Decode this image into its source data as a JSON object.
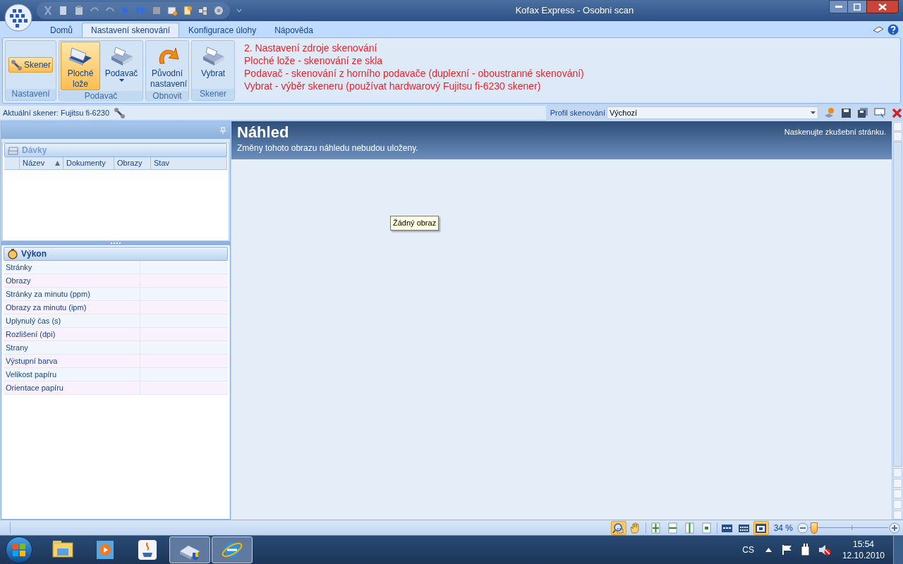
{
  "window": {
    "title": "Kofax Express - Osobni scan"
  },
  "tabs": [
    {
      "label": "Domů",
      "selected": false
    },
    {
      "label": "Nastavení skenování",
      "selected": true
    },
    {
      "label": "Konfigurace úlohy",
      "selected": false
    },
    {
      "label": "Nápověda",
      "selected": false
    }
  ],
  "ribbon": {
    "groups": [
      {
        "label": "Nastavení",
        "buttons": [
          {
            "label": "Skener",
            "kind": "setup",
            "selected": true
          }
        ]
      },
      {
        "label": "Podavač",
        "buttons": [
          {
            "label": "Ploché lože",
            "kind": "flatbed",
            "selected": true
          },
          {
            "label": "Podavač",
            "kind": "feeder",
            "selected": false,
            "has_menu": true
          }
        ]
      },
      {
        "label": "Obnovit",
        "buttons": [
          {
            "label": "Původní nastavení",
            "kind": "reset",
            "selected": false
          }
        ]
      },
      {
        "label": "Skener",
        "buttons": [
          {
            "label": "Vybrat",
            "kind": "select",
            "selected": false
          }
        ]
      }
    ],
    "notes": [
      "2. Nastavení zdroje skenování",
      "Ploché lože - skenování ze skla",
      "Podavač - skenování z horního podavače (duplexní - oboustranné skenování)",
      "Vybrat - výběr skeneru (používat hardwarový Fujitsu fi-6230 skener)"
    ]
  },
  "scanner_bar": {
    "current_scanner": "Aktuální skener: Fujitsu fi-6230",
    "profile_label": "Profil skenování",
    "profile_value": "Výchozí"
  },
  "batches": {
    "title": "Dávky",
    "columns": [
      {
        "label": "Název",
        "sorted": true
      },
      {
        "label": "Dokumenty",
        "sorted": false
      },
      {
        "label": "Obrazy",
        "sorted": false
      },
      {
        "label": "Stav",
        "sorted": false
      }
    ]
  },
  "performance": {
    "title": "Výkon",
    "rows": [
      "Stránky",
      "Obrazy",
      "Stránky za minutu (ppm)",
      "Obrazy za minutu (ipm)",
      "Uplynulý čas (s)",
      "Rozlišení (dpi)",
      "Strany",
      "Výstupní barva",
      "Velikost papíru",
      "Orientace papíru"
    ]
  },
  "preview": {
    "title": "Náhled",
    "subtitle": "Změny tohoto obrazu náhledu nebudou uloženy.",
    "hint": "Naskenujte zkušební stránku.",
    "tooltip": "Žádný obraz"
  },
  "status_bar": {
    "tools": [
      {
        "kind": "zoom",
        "selected": true
      },
      {
        "kind": "hand",
        "selected": false
      },
      {
        "kind": "fit",
        "selected": false
      },
      {
        "kind": "width",
        "selected": false
      },
      {
        "kind": "height",
        "selected": false
      },
      {
        "kind": "actual",
        "selected": false
      },
      {
        "kind": "grid1",
        "selected": false
      },
      {
        "kind": "grid2",
        "selected": false
      },
      {
        "kind": "single",
        "selected": true
      }
    ],
    "zoom": "34 %",
    "zoom_slider": {
      "level": 0.06
    }
  },
  "taskbar": {
    "apps": [
      {
        "kind": "folder",
        "active": false
      },
      {
        "kind": "media",
        "active": false
      },
      {
        "kind": "java",
        "active": false
      },
      {
        "kind": "scanner",
        "active": true
      },
      {
        "kind": "browser",
        "active": true
      }
    ],
    "language": "CS",
    "time": "15:54",
    "date": "12.10.2010"
  }
}
